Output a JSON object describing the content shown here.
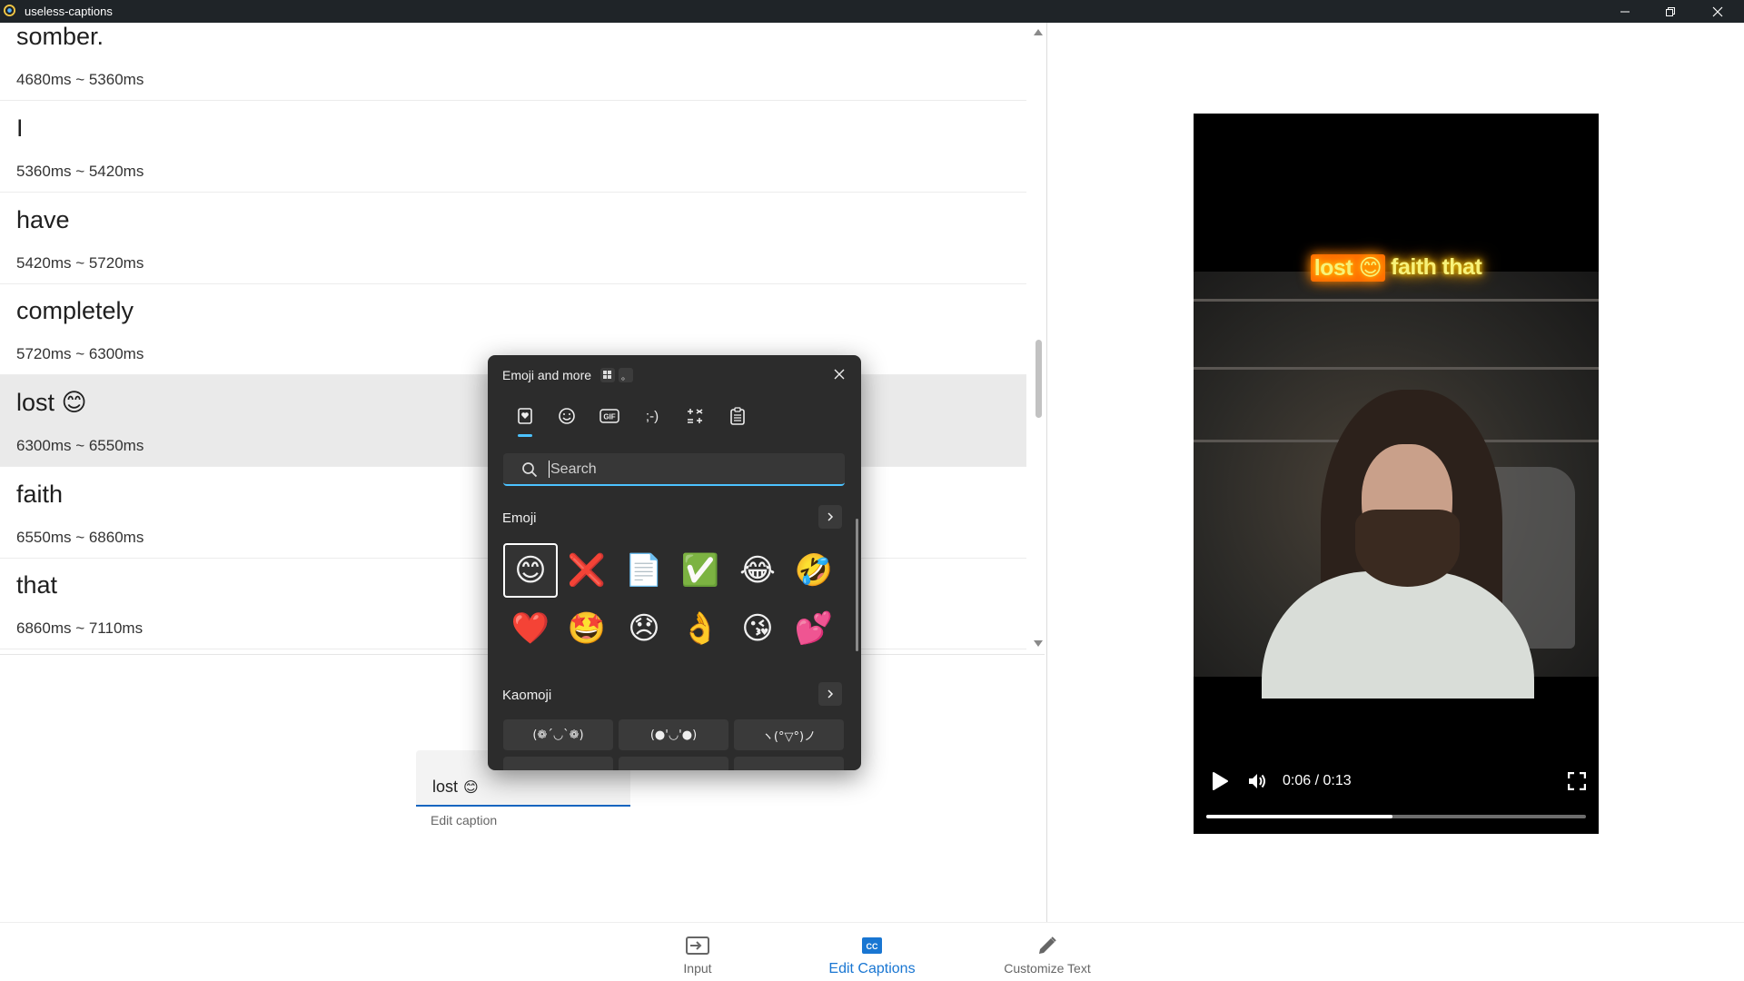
{
  "window": {
    "title": "useless-captions"
  },
  "captions": [
    {
      "word": "somber.",
      "emoji": "",
      "time": "4680ms ~ 5360ms"
    },
    {
      "word": "I",
      "emoji": "",
      "time": "5360ms ~ 5420ms"
    },
    {
      "word": "have",
      "emoji": "",
      "time": "5420ms ~ 5720ms"
    },
    {
      "word": "completely",
      "emoji": "",
      "time": "5720ms ~ 6300ms"
    },
    {
      "word": "lost",
      "emoji": "😊",
      "time": "6300ms ~ 6550ms"
    },
    {
      "word": "faith",
      "emoji": "",
      "time": "6550ms ~ 6860ms"
    },
    {
      "word": "that",
      "emoji": "",
      "time": "6860ms ~ 7110ms"
    }
  ],
  "video": {
    "overlay": {
      "word1": "lost",
      "emoji": "😊",
      "word2": "faith",
      "word3": "that"
    },
    "time": "0:06 / 0:13",
    "progress": 0.49
  },
  "edit": {
    "value": "lost",
    "emoji": "😊",
    "helper": "Edit caption"
  },
  "nav": {
    "input": "Input",
    "edit_captions": "Edit Captions",
    "customize": "Customize Text"
  },
  "emoji_panel": {
    "title": "Emoji and more",
    "badge2": "。",
    "search_placeholder": "Search",
    "section_emoji": "Emoji",
    "section_kaomoji": "Kaomoji",
    "emojis": [
      "😊",
      "❌",
      "📄",
      "✅",
      "😂",
      "🤣",
      "❤️",
      "🤩",
      "😞",
      "👌",
      "😘",
      "💕"
    ],
    "kaomoji": [
      "(❁´◡`❁)",
      "(●'◡'●)",
      "ヽ(°▽°)ノ"
    ],
    "tab_emoticon": ";-)",
    "tab_gif": "GIF"
  },
  "colors": {
    "accent": "#1976d2",
    "selected_row": "#eaeaea",
    "panel_bg": "#2c2c2c",
    "win_accent": "#4cc2ff"
  }
}
